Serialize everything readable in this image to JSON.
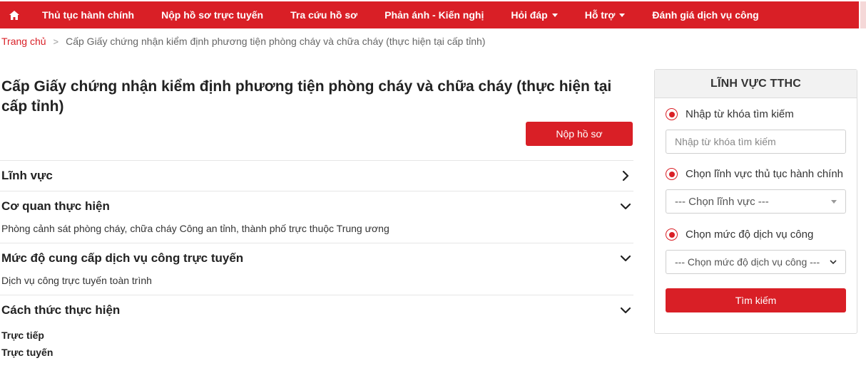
{
  "nav": {
    "home_icon": "home-icon",
    "items": [
      {
        "label": "Thủ tục hành chính",
        "dropdown": false
      },
      {
        "label": "Nộp hồ sơ trực tuyến",
        "dropdown": false
      },
      {
        "label": "Tra cứu hồ sơ",
        "dropdown": false
      },
      {
        "label": "Phản ánh - Kiến nghị",
        "dropdown": false
      },
      {
        "label": "Hỏi đáp",
        "dropdown": true
      },
      {
        "label": "Hỗ trợ",
        "dropdown": true
      },
      {
        "label": "Đánh giá dịch vụ công",
        "dropdown": false
      }
    ],
    "color": "#d91f26"
  },
  "breadcrumb": {
    "home": "Trang chủ",
    "separator": ">",
    "current": "Cấp Giấy chứng nhận kiểm định phương tiện phòng cháy và chữa cháy (thực hiện tại cấp tỉnh)"
  },
  "main": {
    "title": "Cấp Giấy chứng nhận kiểm định phương tiện phòng cháy và chữa cháy (thực hiện tại cấp tỉnh)",
    "submit_label": "Nộp hồ sơ",
    "sections": [
      {
        "title": "Lĩnh vực",
        "expanded": false
      },
      {
        "title": "Cơ quan thực hiện",
        "expanded": true,
        "content": "Phòng cảnh sát phòng cháy, chữa cháy Công an tỉnh, thành phố trực thuộc Trung ương"
      },
      {
        "title": "Mức độ cung cấp dịch vụ công trực tuyến",
        "expanded": true,
        "content": "Dịch vụ công trực tuyến toàn trình"
      },
      {
        "title": "Cách thức thực hiện",
        "expanded": true,
        "lines": [
          "Trực tiếp",
          "Trực tuyến"
        ]
      }
    ]
  },
  "sidebar": {
    "heading": "LĨNH VỰC TTHC",
    "keyword_radio": "Nhập từ khóa tìm kiếm",
    "keyword_placeholder": "Nhập từ khóa tìm kiếm",
    "field_radio": "Chọn lĩnh vực thủ tục hành chính",
    "field_select": "--- Chọn lĩnh vực ---",
    "level_radio": "Chọn mức độ dịch vụ công",
    "level_select": "--- Chọn mức độ dịch vụ công ---",
    "search_label": "Tìm kiếm"
  }
}
